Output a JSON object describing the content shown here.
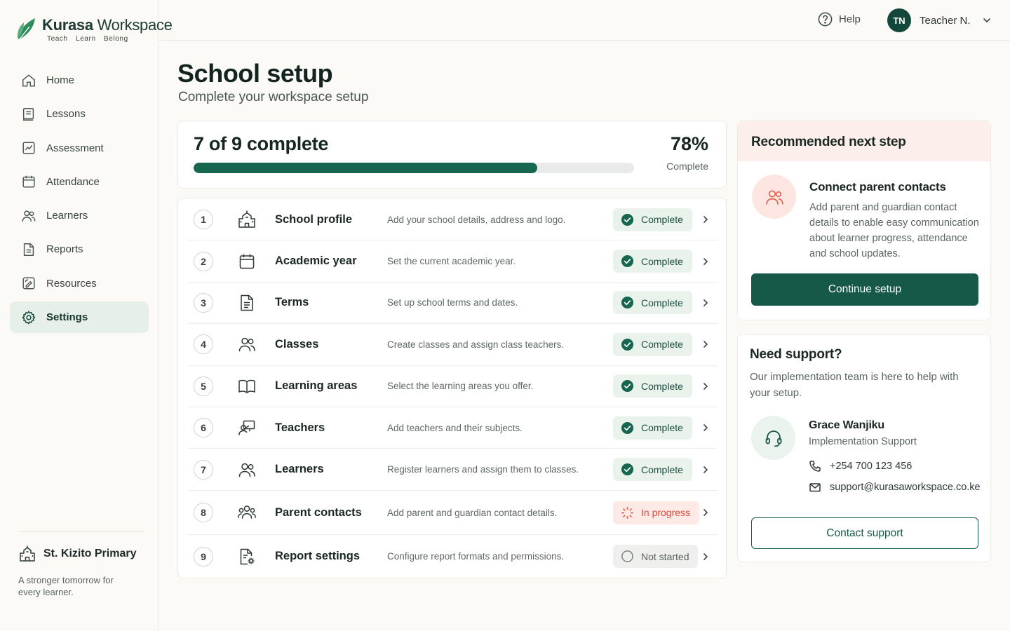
{
  "brand": {
    "name_bold": "Kurasa",
    "name_light": "Workspace",
    "tagline": "Teach Learn Belong"
  },
  "nav": {
    "items": [
      {
        "label": "Home",
        "icon": "home-icon"
      },
      {
        "label": "Lessons",
        "icon": "lessons-icon"
      },
      {
        "label": "Assessment",
        "icon": "assessment-icon"
      },
      {
        "label": "Attendance",
        "icon": "calendar-icon"
      },
      {
        "label": "Learners",
        "icon": "users-icon"
      },
      {
        "label": "Reports",
        "icon": "report-icon"
      },
      {
        "label": "Resources",
        "icon": "resources-icon"
      },
      {
        "label": "Settings",
        "icon": "gear-icon",
        "active": true
      }
    ]
  },
  "school": {
    "name": "St. Kizito Primary",
    "motto": "A stronger tomorrow for every learner."
  },
  "topbar": {
    "help_label": "Help",
    "user_initials": "TN",
    "user_name": "Teacher N."
  },
  "page": {
    "title": "School setup",
    "subtitle": "Complete your workspace setup"
  },
  "progress": {
    "summary": "7 of 9 complete",
    "percent_label": "78%",
    "percent_value": 0.78,
    "percent_caption": "Complete"
  },
  "steps": [
    {
      "num": "1",
      "name": "School profile",
      "desc": "Add your school details, address and logo.",
      "status": "Complete",
      "state": "complete",
      "icon": "school-icon"
    },
    {
      "num": "2",
      "name": "Academic year",
      "desc": "Set the current academic year.",
      "status": "Complete",
      "state": "complete",
      "icon": "calendar-icon"
    },
    {
      "num": "3",
      "name": "Terms",
      "desc": "Set up school terms and dates.",
      "status": "Complete",
      "state": "complete",
      "icon": "document-icon"
    },
    {
      "num": "4",
      "name": "Classes",
      "desc": "Create classes and assign class teachers.",
      "status": "Complete",
      "state": "complete",
      "icon": "users-icon"
    },
    {
      "num": "5",
      "name": "Learning areas",
      "desc": "Select the learning areas you offer.",
      "status": "Complete",
      "state": "complete",
      "icon": "book-icon"
    },
    {
      "num": "6",
      "name": "Teachers",
      "desc": "Add teachers and their subjects.",
      "status": "Complete",
      "state": "complete",
      "icon": "teacher-icon"
    },
    {
      "num": "7",
      "name": "Learners",
      "desc": "Register learners and assign them to classes.",
      "status": "Complete",
      "state": "complete",
      "icon": "users-icon"
    },
    {
      "num": "8",
      "name": "Parent contacts",
      "desc": "Add parent and guardian contact details.",
      "status": "In progress",
      "state": "progress",
      "icon": "group-icon"
    },
    {
      "num": "9",
      "name": "Report settings",
      "desc": "Configure report formats and permissions.",
      "status": "Not started",
      "state": "notstarted",
      "icon": "document-gear-icon"
    }
  ],
  "recommended": {
    "heading": "Recommended next step",
    "title": "Connect parent contacts",
    "description": "Add parent and guardian contact details to enable easy communication about learner progress, attendance and school updates.",
    "button": "Continue setup"
  },
  "support": {
    "heading": "Need support?",
    "description": "Our implementation team is here to help with your setup.",
    "agent_name": "Grace Wanjiku",
    "agent_role": "Implementation Support",
    "phone": "+254 700 123 456",
    "email": "support@kurasaworkspace.co.ke",
    "button": "Contact support"
  },
  "colors": {
    "primary": "#175949",
    "progress_fill": "#17664f",
    "complete_bg": "#e9f3ec",
    "in_progress": "#d94c3a",
    "recommend_bg": "#fcefeb"
  }
}
